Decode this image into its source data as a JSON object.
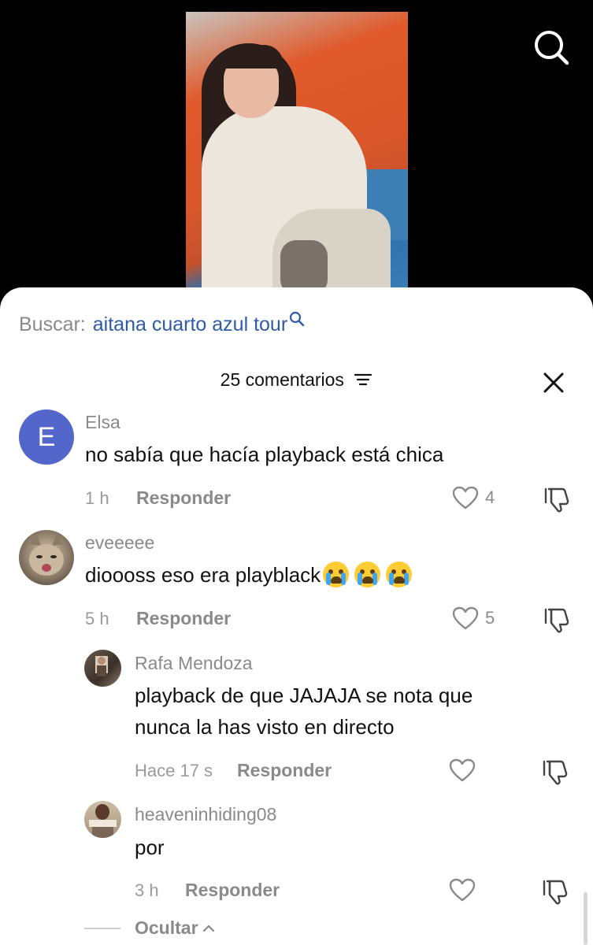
{
  "search": {
    "prefix": "Buscar:",
    "term": "aitana cuarto azul tour"
  },
  "header": {
    "count_label": "25 comentarios"
  },
  "comments": [
    {
      "user": "Elsa",
      "avatar_letter": "E",
      "text": "no sabía que hacía playback está chica",
      "time": "1 h",
      "reply_label": "Responder",
      "likes": "4"
    },
    {
      "user": "eveeeee",
      "text": "dioooss eso era playblack",
      "emoji": "crying-face x3",
      "time": "5 h",
      "reply_label": "Responder",
      "likes": "5"
    }
  ],
  "replies": [
    {
      "user": "Rafa Mendoza",
      "text_line1": "playback de que JAJAJA se nota que",
      "text_line2": "nunca la has visto en directo",
      "time": "Hace 17 s",
      "reply_label": "Responder"
    },
    {
      "user": "heaveninhiding08",
      "text": "por",
      "time": "3 h",
      "reply_label": "Responder"
    }
  ],
  "hide_label": "Ocultar",
  "colors": {
    "accent_link": "#2e5ba8",
    "avatar_letter_bg": "#5366c9",
    "muted_text": "#8a8a8a"
  }
}
